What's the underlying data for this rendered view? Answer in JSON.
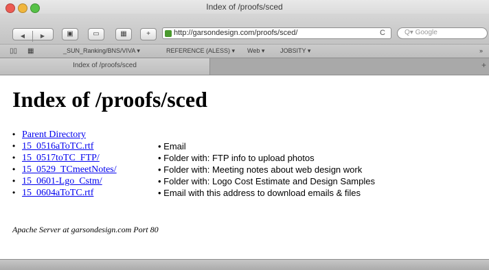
{
  "window": {
    "title": "Index of /proofs/sced"
  },
  "toolbar": {
    "back_icon": "back-arrow-icon",
    "forward_icon": "forward-arrow-icon",
    "url": "http://garsondesign.com/proofs/sced/",
    "reload_symbol": "C",
    "search_placeholder": "Q▾ Google"
  },
  "bookmarks": [
    "_SUN_Ranking/BNS/VIVA ▾",
    "REFERENCE (ALESS) ▾",
    "Web ▾",
    "JOBSITY ▾"
  ],
  "tabs": [
    {
      "label": "Index of /proofs/sced"
    }
  ],
  "page": {
    "heading": "Index of /proofs/sced",
    "entries": [
      {
        "name": "Parent Directory",
        "description": ""
      },
      {
        "name": "15_0516aToTC.rtf",
        "description": "• Email"
      },
      {
        "name": "15_0517toTC_FTP/",
        "description": "• Folder with: FTP info to upload photos"
      },
      {
        "name": "15_0529_TCmeetNotes/",
        "description": "• Folder with: Meeting notes about web design work"
      },
      {
        "name": "15_0601-Lgo_Cstm/",
        "description": "• Folder with: Logo Cost Estimate and Design Samples"
      },
      {
        "name": "15_0604aToTC.rtf",
        "description": "• Email with this address to download emails & files"
      }
    ],
    "address": "Apache Server at garsondesign.com Port 80"
  },
  "colors": {
    "link": "#0000ee",
    "traffic_red": "#ec5b53",
    "traffic_yellow": "#f0b63d",
    "traffic_green": "#56c146"
  }
}
